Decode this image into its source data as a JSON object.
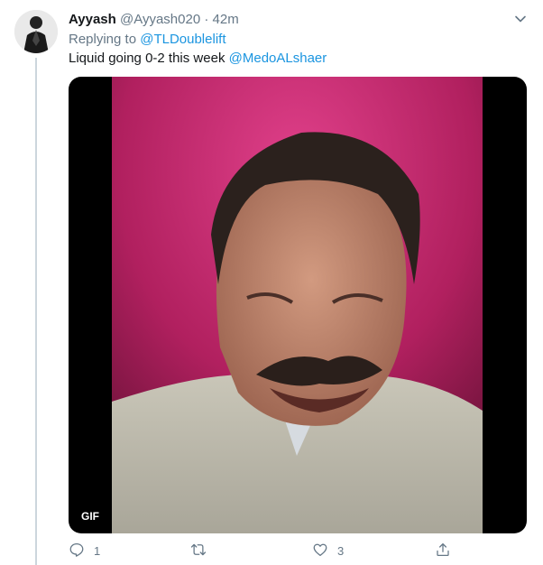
{
  "tweet": {
    "author_name": "Ayyash",
    "author_handle": "@Ayyash020",
    "separator": "·",
    "timestamp": "42m",
    "replying_to_label": "Replying to",
    "replying_to_handle": "@TLDoublelift",
    "text": "Liquid going 0-2 this week",
    "mention": "@MedoALshaer",
    "media_badge": "GIF"
  },
  "actions": {
    "reply_count": "1",
    "retweet_count": "",
    "like_count": "3"
  },
  "icons": [
    "avatar",
    "chevron-down-icon",
    "reply-icon",
    "retweet-icon",
    "like-icon",
    "share-icon"
  ],
  "colors": {
    "link": "#1b95e0",
    "name": "#14171a",
    "secondary": "#657786",
    "thread_line": "#ccd6dd"
  }
}
